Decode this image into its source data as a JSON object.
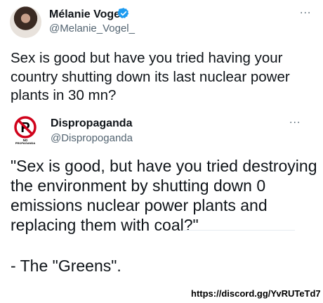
{
  "tweet": {
    "author_name": "Mélanie Vogel",
    "author_handle": "@Melanie_Vogel_",
    "more_label": "...",
    "text": "Sex is good but have you tried having your country shutting down its last nuclear power plants in 30 mn?",
    "verified_icon": "verified-badge-icon"
  },
  "quoted_tweet": {
    "author_name": "Dispropaganda",
    "author_handle": "@Dispropoganda",
    "more_label": "...",
    "avatar_caption": "NO PROPAGANDA",
    "text": "\"Sex is good, but have you tried destroying the environment by shutting down 0 emissions nuclear power plants and replacing them with coal?\"",
    "signature": "- The \"Greens\"."
  },
  "watermark": "https://discord.gg/YvRUTeTd7",
  "colors": {
    "verified": "#1d9bf0",
    "text": "#0f1419",
    "secondary": "#536471",
    "no_sign": "#d0021b"
  }
}
